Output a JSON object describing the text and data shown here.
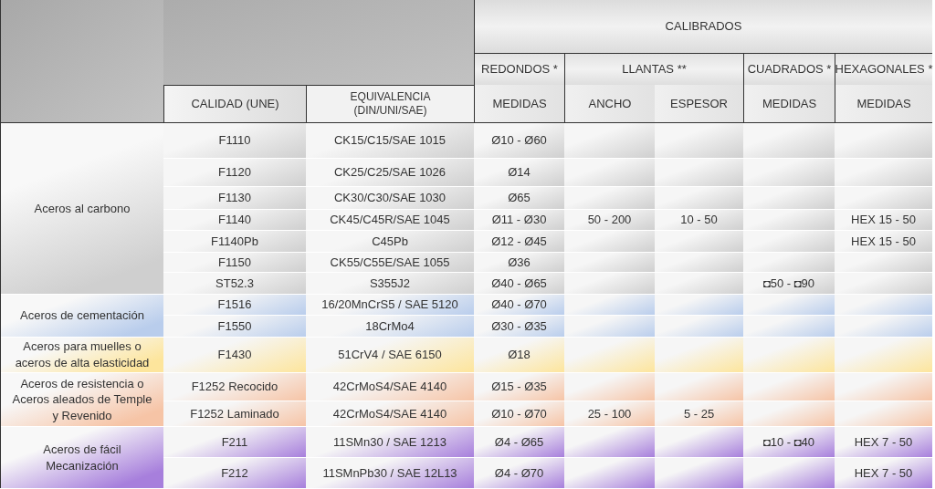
{
  "header": {
    "title": "CALIBRADOS",
    "calidad": "CALIDAD (UNE)",
    "equivalencia": [
      "EQUIVALENCIA",
      "(DIN/UNI/SAE)"
    ],
    "groups": [
      {
        "label": "REDONDOS *",
        "subcolumns": [
          "MEDIDAS"
        ]
      },
      {
        "label": "LLANTAS **",
        "subcolumns": [
          "ANCHO",
          "ESPESOR"
        ]
      },
      {
        "label": "CUADRADOS *",
        "subcolumns": [
          "MEDIDAS"
        ]
      },
      {
        "label": "HEXAGONALES *",
        "subcolumns": [
          "MEDIDAS"
        ]
      }
    ]
  },
  "groups": [
    {
      "name": "Aceros al carbono",
      "color": "#cfcfcf",
      "rows": [
        {
          "calidad": "F1110",
          "equivalencia": "CK15/C15/SAE 1015",
          "redondos": "Ø10 - Ø60"
        },
        {
          "calidad": "F1120",
          "equivalencia": "CK25/C25/SAE 1026",
          "redondos": "Ø14"
        },
        {
          "calidad": "F1130",
          "equivalencia": "CK30/C30/SAE 1030",
          "redondos": "Ø65"
        },
        {
          "calidad": "F1140",
          "equivalencia": "CK45/C45R/SAE 1045",
          "redondos": "Ø11 - Ø30",
          "ancho": "50 - 200",
          "espesor": "10 - 50",
          "hexagonales": "HEX 15 - 50"
        },
        {
          "calidad": "F1140Pb",
          "equivalencia": "C45Pb",
          "redondos": "Ø12 - Ø45",
          "hexagonales": "HEX 15 - 50"
        },
        {
          "calidad": "F1150",
          "equivalencia": "CK55/C55E/SAE 1055",
          "redondos": "Ø36"
        },
        {
          "calidad": "ST52.3",
          "equivalencia": "S355J2",
          "redondos": "Ø40 - Ø65",
          "cuadrados": "◘50 - ◘90"
        }
      ]
    },
    {
      "name": "Aceros de cementación",
      "color": "#b9cdec",
      "rows": [
        {
          "calidad": "F1516",
          "equivalencia": "16/20MnCrS5 / SAE 5120",
          "redondos": "Ø40 - Ø70"
        },
        {
          "calidad": "F1550",
          "equivalencia": "18CrMo4",
          "redondos": "Ø30 - Ø35"
        }
      ]
    },
    {
      "name": "Aceros para muelles o aceros de alta elasticidad",
      "color": "#fde59c",
      "rows": [
        {
          "calidad": "F1430",
          "equivalencia": "51CrV4 / SAE 6150",
          "redondos": "Ø18"
        }
      ]
    },
    {
      "name": "Aceros de resistencia o Aceros aleados de Temple y Revenido",
      "color": "#f6c4a6",
      "rows": [
        {
          "calidad": "F1252 Recocido",
          "equivalencia": "42CrMoS4/SAE 4140",
          "redondos": "Ø15 - Ø35"
        },
        {
          "calidad": "F1252 Laminado",
          "equivalencia": "42CrMoS4/SAE 4140",
          "redondos": "Ø10 - Ø70",
          "ancho": "25 - 100",
          "espesor": "5 - 25"
        }
      ]
    },
    {
      "name": "Aceros de fácil Mecanización",
      "color": "#a77fdc",
      "rows": [
        {
          "calidad": "F211",
          "equivalencia": "11SMn30 / SAE 1213",
          "redondos": "Ø4 - Ø65",
          "cuadrados": "◘10 - ◘40",
          "hexagonales": "HEX 7 - 50"
        },
        {
          "calidad": "F212",
          "equivalencia": "11SMnPb30 / SAE 12L13",
          "redondos": "Ø4 - Ø70",
          "hexagonales": "HEX 7 - 50"
        }
      ]
    }
  ]
}
